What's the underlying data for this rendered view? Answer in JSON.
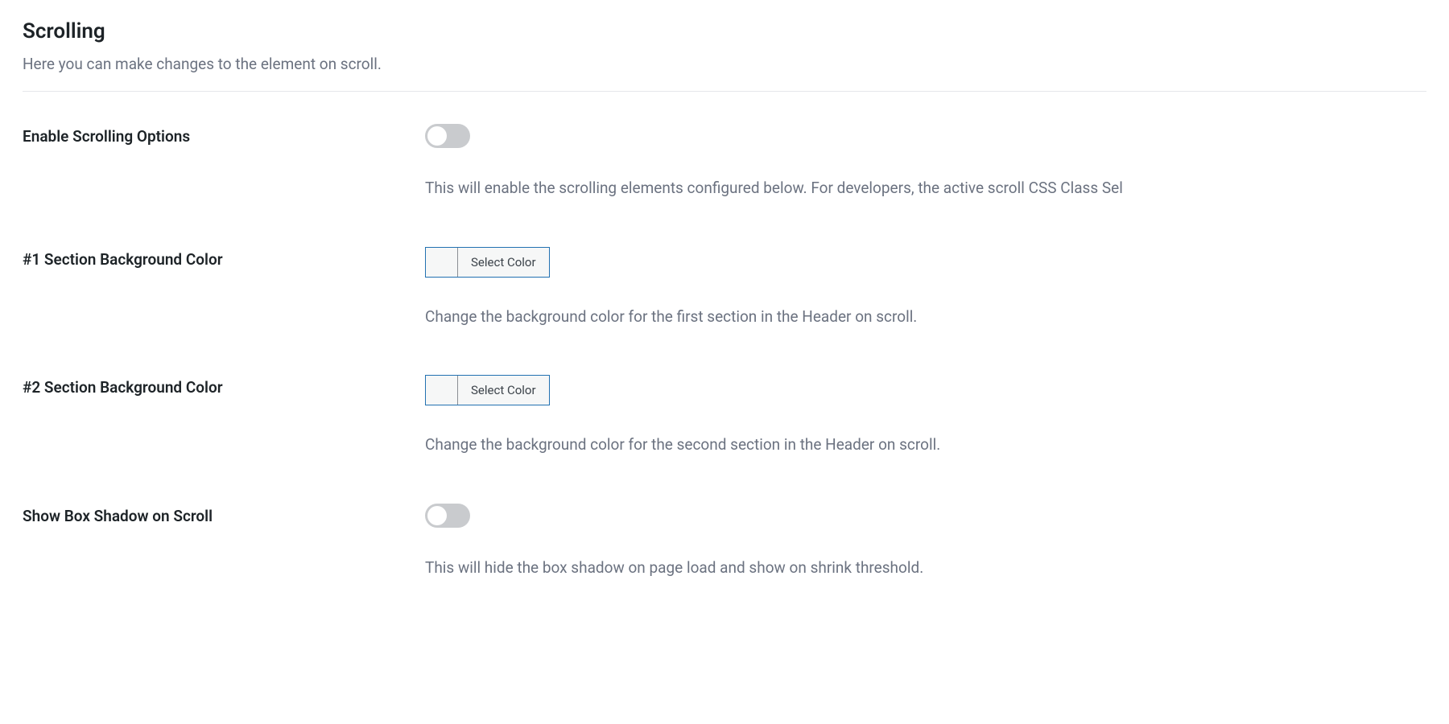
{
  "section": {
    "title": "Scrolling",
    "subtitle": "Here you can make changes to the element on scroll."
  },
  "fields": {
    "enable_scrolling": {
      "label": "Enable Scrolling Options",
      "help": "This will enable the scrolling elements configured below. For developers, the active scroll CSS Class Sel"
    },
    "section1_bg": {
      "label": "#1 Section Background Color",
      "button": "Select Color",
      "help": "Change the background color for the first section in the Header on scroll."
    },
    "section2_bg": {
      "label": "#2 Section Background Color",
      "button": "Select Color",
      "help": "Change the background color for the second section in the Header on scroll."
    },
    "box_shadow": {
      "label": "Show Box Shadow on Scroll",
      "help": "This will hide the box shadow on page load and show on shrink threshold."
    }
  }
}
